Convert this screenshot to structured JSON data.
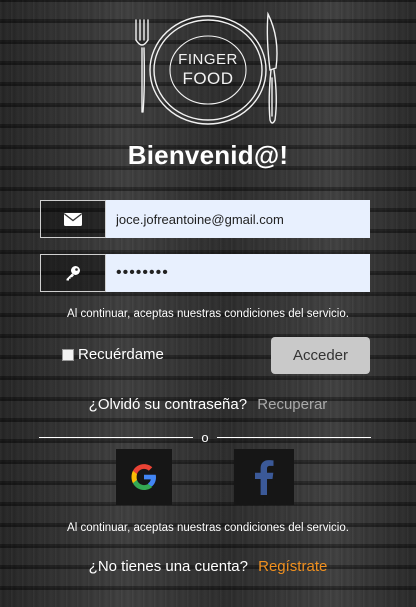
{
  "brand": {
    "logo_line1": "FINGER",
    "logo_line2": "FOOD"
  },
  "welcome_title": "Bienvenid@!",
  "login_form": {
    "email_value": "joce.jofreantoine@gmail.com",
    "password_value": "••••••••",
    "terms_text": "Al continuar, aceptas nuestras condiciones del servicio.",
    "remember_label": "Recuérdame",
    "remember_checked": false,
    "submit_label": "Acceder"
  },
  "forgot": {
    "question": "¿Olvidó su contraseña?",
    "link": "Recuperar"
  },
  "divider_text": "o",
  "social": {
    "terms_text": "Al continuar, aceptas nuestras condiciones del servicio."
  },
  "signup": {
    "question": "¿No tienes una cuenta?",
    "link": "Regístrate"
  },
  "colors": {
    "accent": "#f0901f",
    "input_bg": "#e8f0fe",
    "button_bg": "#c9c9c9",
    "facebook": "#3b5998"
  },
  "icons": [
    "fork-icon",
    "knife-icon",
    "envelope-icon",
    "key-icon",
    "google-icon",
    "facebook-icon"
  ]
}
